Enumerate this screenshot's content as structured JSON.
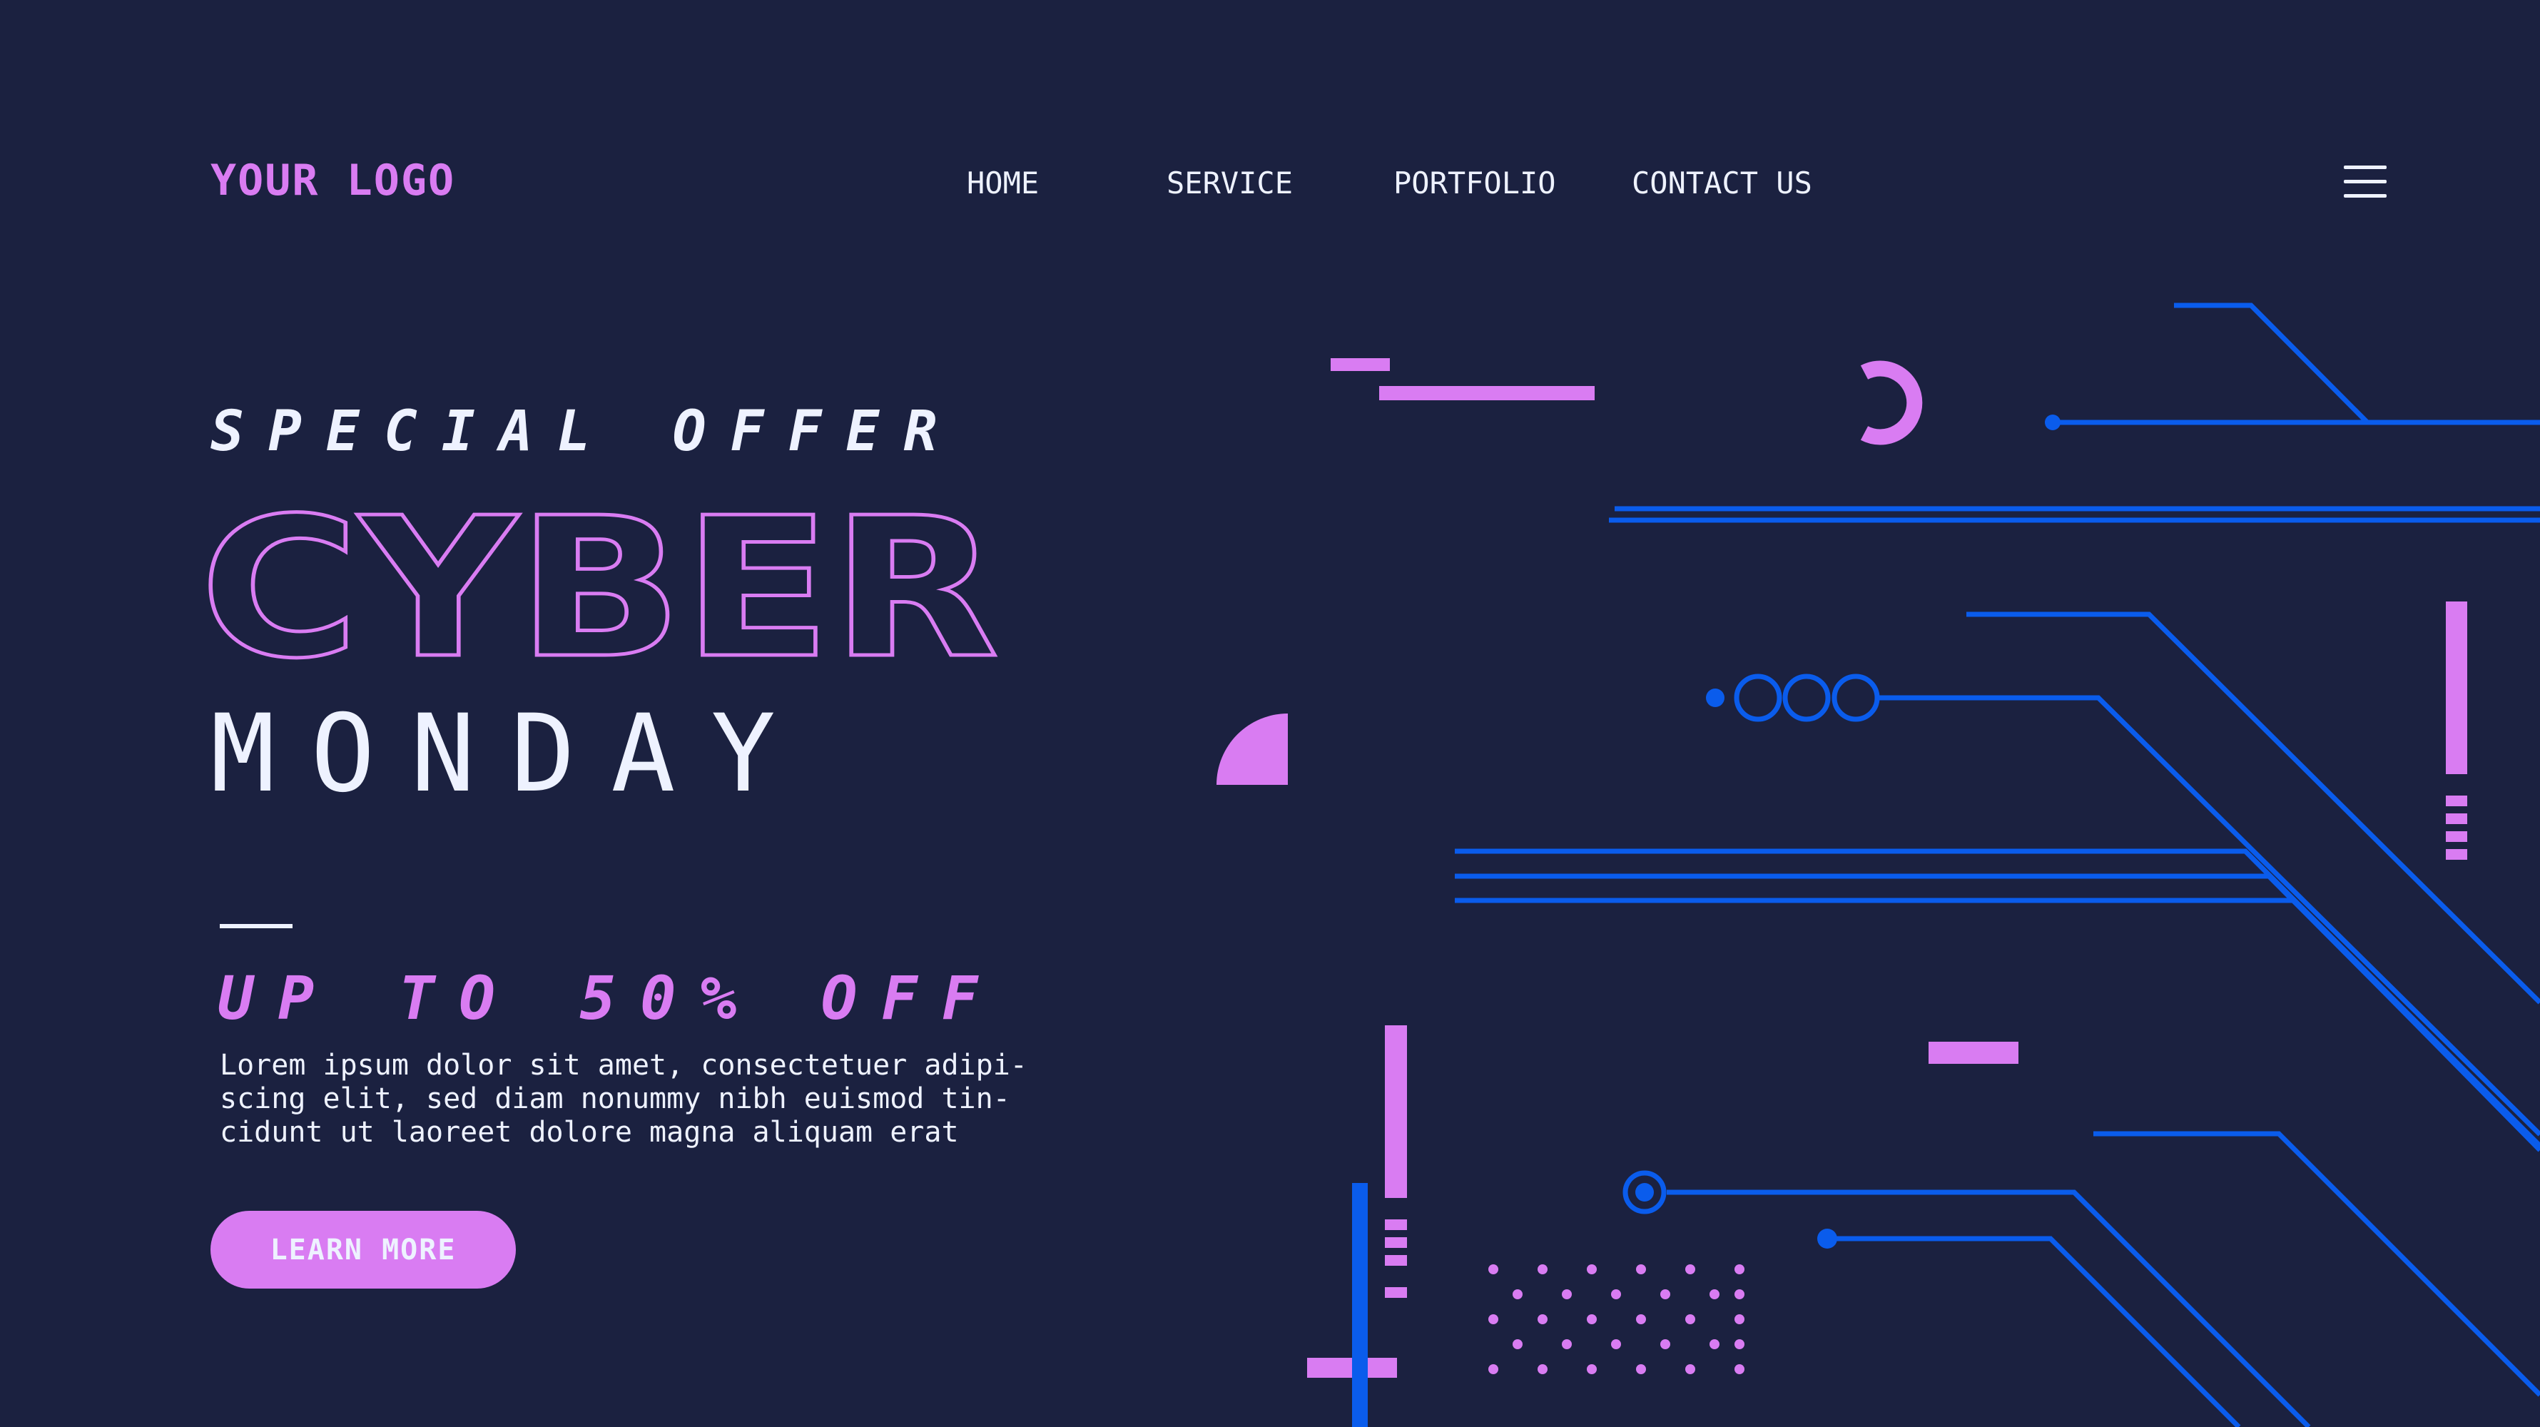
{
  "header": {
    "logo": "YOUR LOGO",
    "nav": [
      "HOME",
      "SERVICE",
      "PORTFOLIO",
      "CONTACT US"
    ],
    "menu_icon": "hamburger-menu-icon"
  },
  "hero": {
    "eyebrow": "SPECIAL OFFER",
    "headline_outline": "CYBER",
    "headline_sub": "MONDAY",
    "discount": "UP TO 50% OFF",
    "body": "Lorem ipsum dolor sit amet, consectetuer adipi-\nscing elit, sed diam nonummy nibh euismod tin-\ncidunt ut laoreet dolore magna aliquam erat",
    "cta_label": "LEARN MORE"
  },
  "colors": {
    "background": "#1b2140",
    "accent_pink": "#d97cf2",
    "circuit_blue": "#0a5cec",
    "text_light": "#eef2ff"
  }
}
